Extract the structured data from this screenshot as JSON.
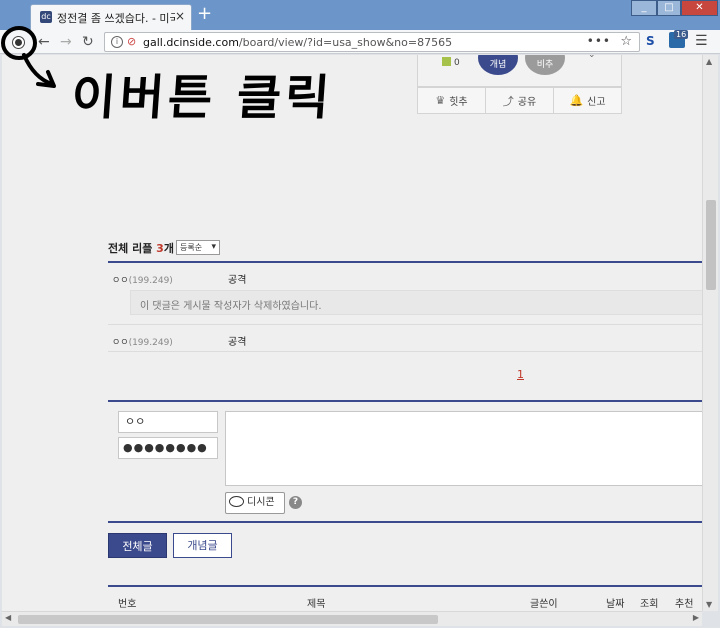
{
  "browser": {
    "tab_title": "정전결 좀 쓰겠습다. - 미국 소",
    "tab_close": "×",
    "new_tab": "+",
    "url_domain": "gall.dcinside.com",
    "url_path": "/board/view/?id=usa_show&no=87565",
    "page_actions": "•••",
    "bookmark_star": "☆",
    "ext_s_label": "S",
    "ext_badge": "16",
    "menu": "☰",
    "back": "←",
    "forward": "→",
    "reload": "↻",
    "win_min": "_",
    "win_max": "□",
    "win_close": "✕"
  },
  "annotation_text": "이버튼 클릭",
  "recommend": {
    "count": "0",
    "up_label": "개념",
    "down_label": "비추",
    "chevron": "⌄",
    "actions": [
      {
        "icon": "♛",
        "label": "힛추"
      },
      {
        "icon": "⤴",
        "label": "공유"
      },
      {
        "icon": "🔔",
        "label": "신고"
      }
    ]
  },
  "comments": {
    "header_prefix": "전체 리플",
    "count": "3",
    "count_suffix": "개",
    "sort": "등록순",
    "items": [
      {
        "writer": "ㅇㅇ",
        "ip": "(199.249)",
        "text": "공격"
      },
      {
        "writer": "ㅇㅇ",
        "ip": "(199.249)",
        "text": "공격"
      }
    ],
    "deleted_notice": "이 댓글은 게시물 작성자가 삭제하였습니다.",
    "page_number": "1"
  },
  "form": {
    "name_value": "ㅇㅇ",
    "password_mask": "●●●●●●●●",
    "dccon_label": "디시콘",
    "help": "?"
  },
  "buttons": {
    "all_posts": "전체글",
    "concept_posts": "개념글"
  },
  "board_headers": [
    "번호",
    "제목",
    "글쓴이",
    "날짜",
    "조회",
    "추천"
  ]
}
